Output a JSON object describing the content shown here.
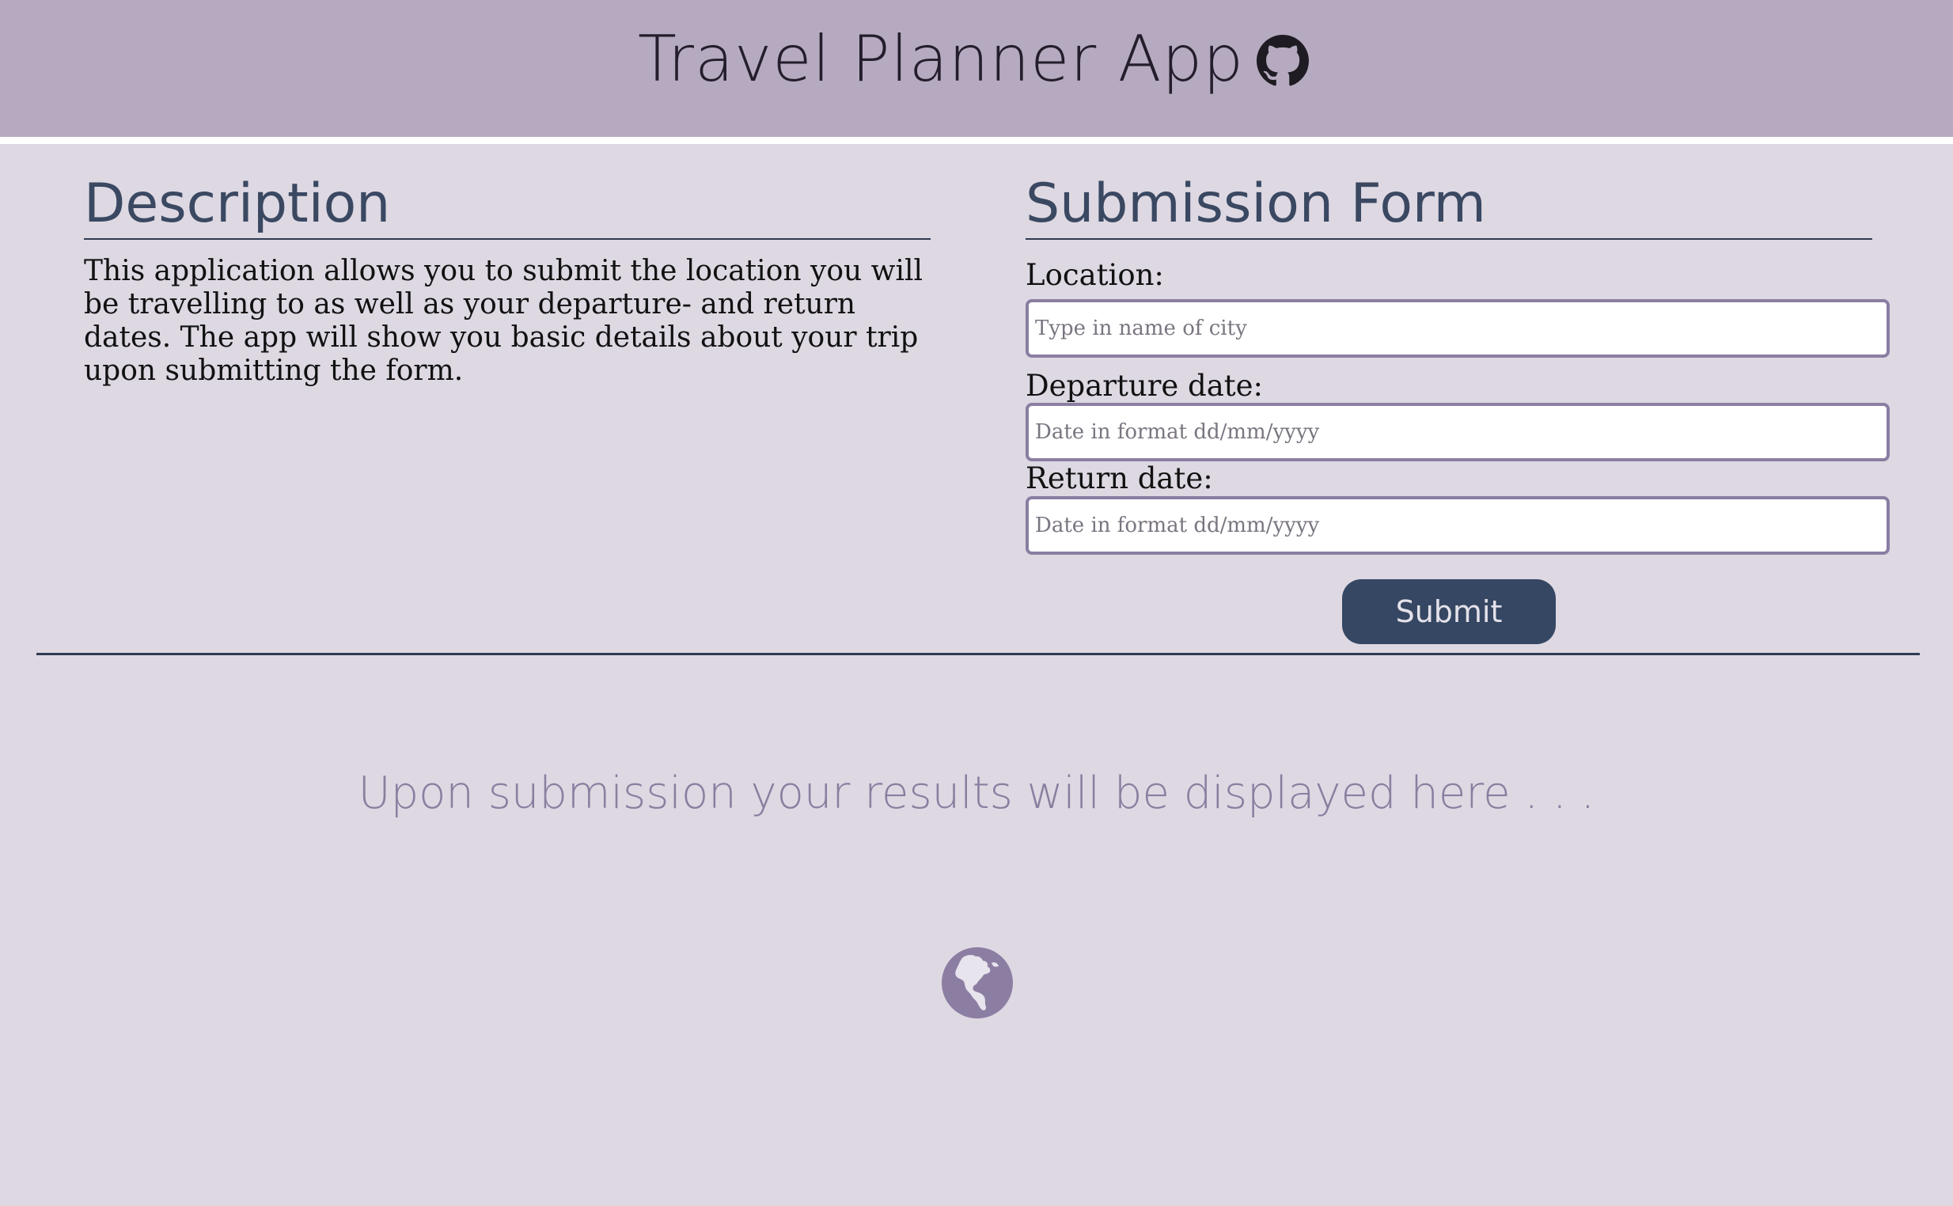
{
  "header": {
    "title": "Travel Planner App",
    "github_icon": "github-icon"
  },
  "description": {
    "heading": "Description",
    "text": "This application allows you to submit the location you will be travelling to as well as your departure- and return dates. The app will show you basic details about your trip upon submitting the form."
  },
  "form": {
    "heading": "Submission Form",
    "location_label": "Location:",
    "location_placeholder": "Type in name of city",
    "departure_label": "Departure date:",
    "departure_placeholder": "Date in format dd/mm/yyyy",
    "return_label": "Return date:",
    "return_placeholder": "Date in format dd/mm/yyyy",
    "submit_label": "Submit"
  },
  "results": {
    "placeholder_text": "Upon submission your results will be displayed here . . .",
    "icon": "globe-icon"
  },
  "colors": {
    "header_bg": "#b6aac0",
    "page_bg": "#ddd8e2",
    "accent_dark": "#364763",
    "accent_purple": "#8a7ea2"
  }
}
